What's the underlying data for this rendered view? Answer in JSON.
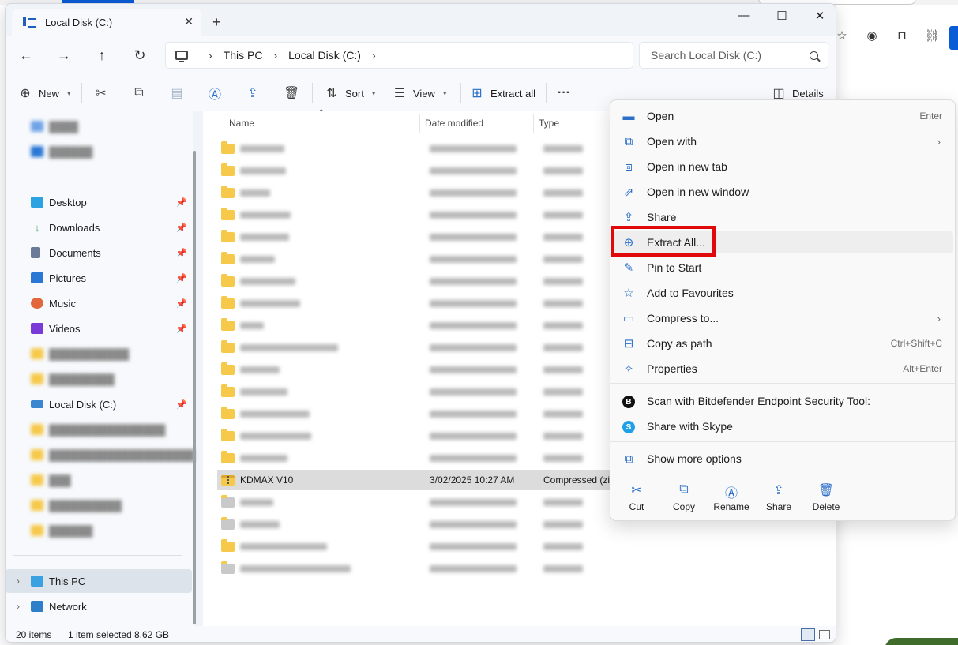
{
  "window": {
    "tab_title": "Local Disk (C:)",
    "new_tab": "+",
    "tab_close": "✕",
    "controls": {
      "minimize": "—",
      "maximize": "☐",
      "close": "✕"
    }
  },
  "nav": {
    "back": "←",
    "forward": "→",
    "up": "↑",
    "refresh": "↻"
  },
  "address": {
    "crumbs": [
      "This PC",
      "Local Disk (C:)"
    ],
    "separator": "›"
  },
  "search": {
    "placeholder": "Search Local Disk (C:)"
  },
  "commandbar": {
    "new_label": "New",
    "sort_label": "Sort",
    "view_label": "View",
    "extract_all_label": "Extract all",
    "more": "···",
    "details_label": "Details"
  },
  "sidebar": {
    "pinned": [
      {
        "label": "Desktop",
        "color": "#2aa3e0"
      },
      {
        "label": "Downloads",
        "color": "#2e9b4f"
      },
      {
        "label": "Documents",
        "color": "#6b7a99"
      },
      {
        "label": "Pictures",
        "color": "#2a78d4"
      },
      {
        "label": "Music",
        "color": "#e0683a"
      },
      {
        "label": "Videos",
        "color": "#7a3ad8"
      },
      {
        "label": "Local Disk (C:)",
        "color": "#3a86d1"
      }
    ],
    "this_pc": "This PC",
    "network": "Network"
  },
  "columns": {
    "name": "Name",
    "date_modified": "Date modified",
    "type": "Type"
  },
  "selected_file": {
    "name": "KDMAX V10",
    "date": "3/02/2025 10:27 AM",
    "type": "Compressed (zipp"
  },
  "status": {
    "items": "20 items",
    "selected": "1 item selected",
    "size": "8.62 GB"
  },
  "context_menu": {
    "items": [
      {
        "label": "Open",
        "shortcut": "Enter",
        "icon": "folder-open-icon",
        "glyph": "▬"
      },
      {
        "label": "Open with",
        "shortcut": "",
        "icon": "open-with-icon",
        "glyph": "⧉",
        "submenu": true
      },
      {
        "label": "Open in new tab",
        "shortcut": "",
        "icon": "new-tab-icon",
        "glyph": "⧈"
      },
      {
        "label": "Open in new window",
        "shortcut": "",
        "icon": "new-window-icon",
        "glyph": "⇗"
      },
      {
        "label": "Share",
        "shortcut": "",
        "icon": "share-icon",
        "glyph": "⇪"
      },
      {
        "label": "Extract All...",
        "shortcut": "",
        "icon": "extract-icon",
        "glyph": "⊕"
      },
      {
        "label": "Pin to Start",
        "shortcut": "",
        "icon": "pin-icon",
        "glyph": "✎"
      },
      {
        "label": "Add to Favourites",
        "shortcut": "",
        "icon": "star-icon",
        "glyph": "☆"
      },
      {
        "label": "Compress to...",
        "shortcut": "",
        "icon": "compress-icon",
        "glyph": "▭",
        "submenu": true
      },
      {
        "label": "Copy as path",
        "shortcut": "Ctrl+Shift+C",
        "icon": "copy-path-icon",
        "glyph": "⊟"
      },
      {
        "label": "Properties",
        "shortcut": "Alt+Enter",
        "icon": "wrench-icon",
        "glyph": "✧"
      }
    ],
    "extras": [
      {
        "label": "Scan with Bitdefender Endpoint Security Tool:",
        "badge": "B"
      },
      {
        "label": "Share with Skype",
        "badge": "S"
      }
    ],
    "more_options": "Show more options",
    "submenu_arrow": "›",
    "quick_actions": [
      {
        "label": "Cut",
        "glyph": "✂"
      },
      {
        "label": "Copy",
        "glyph": "⧉"
      },
      {
        "label": "Rename",
        "glyph": "Ⓐ"
      },
      {
        "label": "Share",
        "glyph": "⇪"
      },
      {
        "label": "Delete",
        "glyph": "🗑"
      }
    ]
  },
  "colors": {
    "accent": "#2b6fc9",
    "highlight_box": "#e10a0a",
    "folder": "#f6c94a",
    "selected_row": "#dcdcdc"
  }
}
